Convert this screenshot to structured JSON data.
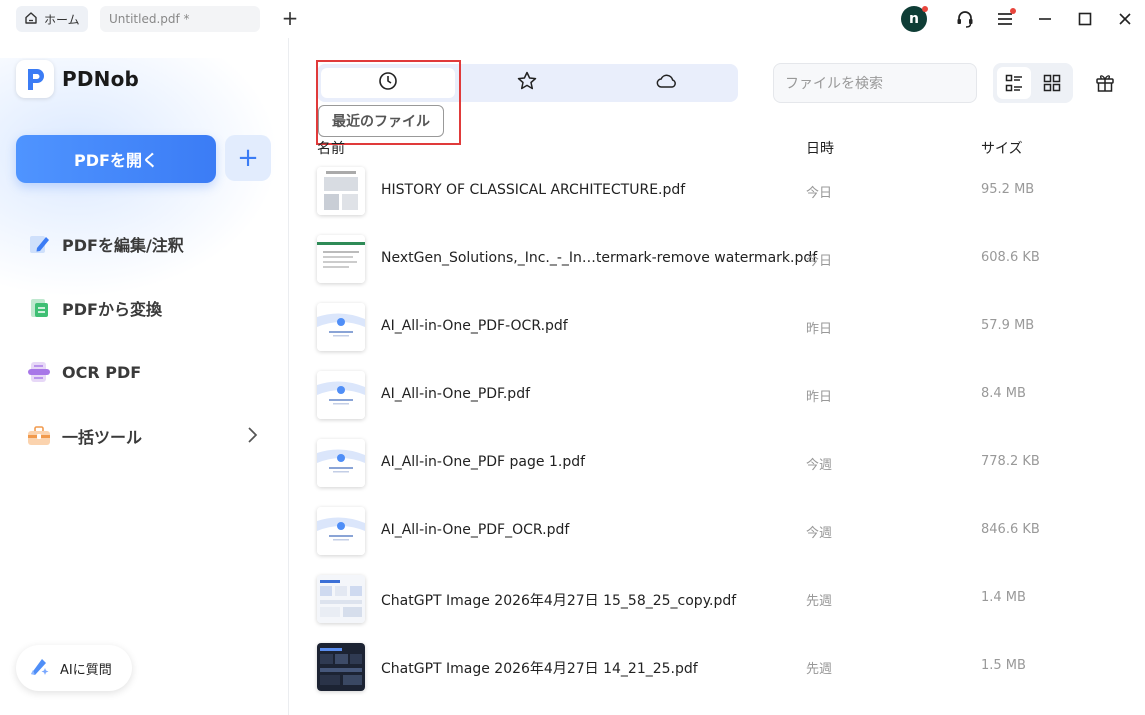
{
  "titlebar": {
    "home_tab": "ホーム",
    "doc_tab": "Untitled.pdf *",
    "new_tab": "+",
    "avatar_letter": "n"
  },
  "sidebar": {
    "brand": "PDNob",
    "open_button": "PDFを開く",
    "add_button": "+",
    "items": [
      {
        "label": "PDFを編集/注釈",
        "icon": "edit-annotate-icon"
      },
      {
        "label": "PDFから変換",
        "icon": "convert-icon"
      },
      {
        "label": "OCR PDF",
        "icon": "ocr-icon"
      },
      {
        "label": "一括ツール",
        "icon": "batch-toolbox-icon"
      }
    ],
    "ai_button": "AIに質問"
  },
  "main": {
    "tabs": [
      {
        "name": "recent",
        "icon": "clock-icon"
      },
      {
        "name": "favorites",
        "icon": "star-icon"
      },
      {
        "name": "cloud",
        "icon": "cloud-icon"
      }
    ],
    "tooltip": "最近のファイル",
    "search_placeholder": "ファイルを検索",
    "columns": {
      "name": "名前",
      "date": "日時",
      "size": "サイズ"
    },
    "files": [
      {
        "name": "HISTORY OF CLASSICAL ARCHITECTURE.pdf",
        "date": "今日",
        "size": "95.2 MB",
        "thumb": "architecture"
      },
      {
        "name": "NextGen_Solutions,_Inc._-_In…termark-remove watermark.pdf",
        "date": "今日",
        "size": "608.6 KB",
        "thumb": "document"
      },
      {
        "name": "AI_All-in-One_PDF-OCR.pdf",
        "date": "昨日",
        "size": "57.9 MB",
        "thumb": "ai-cover"
      },
      {
        "name": "AI_All-in-One_PDF.pdf",
        "date": "昨日",
        "size": "8.4 MB",
        "thumb": "ai-cover"
      },
      {
        "name": "AI_All-in-One_PDF page 1.pdf",
        "date": "今週",
        "size": "778.2 KB",
        "thumb": "ai-cover"
      },
      {
        "name": "AI_All-in-One_PDF_OCR.pdf",
        "date": "今週",
        "size": "846.6 KB",
        "thumb": "ai-cover"
      },
      {
        "name": "ChatGPT Image 2026年4月27日 15_58_25_copy.pdf",
        "date": "先週",
        "size": "1.4 MB",
        "thumb": "infographic-light"
      },
      {
        "name": "ChatGPT Image 2026年4月27日 14_21_25.pdf",
        "date": "先週",
        "size": "1.5 MB",
        "thumb": "infographic-dark"
      }
    ]
  },
  "colors": {
    "accent": "#3b7cf5",
    "highlight_border": "#e03a3a",
    "notification": "#e8453c",
    "avatar_bg": "#0f3d36"
  }
}
